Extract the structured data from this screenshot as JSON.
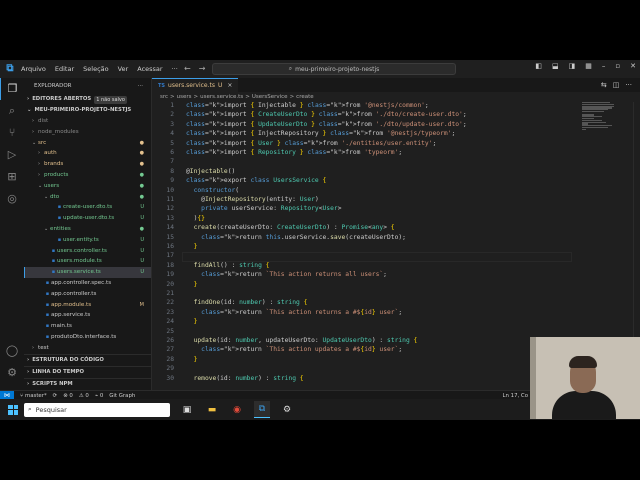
{
  "titlebar": {
    "menu": [
      "Arquivo",
      "Editar",
      "Seleção",
      "Ver",
      "Acessar",
      "···"
    ],
    "command_center": "meu-primeiro-projeto-nestjs"
  },
  "sidebar": {
    "title": "EXPLORADOR",
    "open_editors_label": "EDITORES ABERTOS",
    "unsaved_badge": "1 não salvo",
    "project_label": "MEU-PRIMEIRO-PROJETO-NESTJS",
    "tree": [
      {
        "label": "dist",
        "indent": 1,
        "kind": "folder",
        "collapsed": true,
        "color": "dim",
        "dec": ""
      },
      {
        "label": "node_modules",
        "indent": 1,
        "kind": "folder",
        "collapsed": true,
        "color": "dim",
        "dec": ""
      },
      {
        "label": "src",
        "indent": 1,
        "kind": "folder",
        "collapsed": false,
        "color": "mod",
        "dec": "●"
      },
      {
        "label": "auth",
        "indent": 2,
        "kind": "folder",
        "collapsed": true,
        "color": "mod",
        "dec": "●"
      },
      {
        "label": "brands",
        "indent": 2,
        "kind": "folder",
        "collapsed": true,
        "color": "mod",
        "dec": "●"
      },
      {
        "label": "products",
        "indent": 2,
        "kind": "folder",
        "collapsed": true,
        "color": "unt",
        "dec": "●"
      },
      {
        "label": "users",
        "indent": 2,
        "kind": "folder",
        "collapsed": false,
        "color": "unt",
        "dec": "●"
      },
      {
        "label": "dto",
        "indent": 3,
        "kind": "folder",
        "collapsed": false,
        "color": "unt",
        "dec": "●"
      },
      {
        "label": "create-user.dto.ts",
        "indent": 4,
        "kind": "ts",
        "color": "unt",
        "dec": "U"
      },
      {
        "label": "update-user.dto.ts",
        "indent": 4,
        "kind": "ts",
        "color": "unt",
        "dec": "U"
      },
      {
        "label": "entities",
        "indent": 3,
        "kind": "folder",
        "collapsed": false,
        "color": "unt",
        "dec": "●"
      },
      {
        "label": "user.entity.ts",
        "indent": 4,
        "kind": "ts",
        "color": "unt",
        "dec": "U"
      },
      {
        "label": "users.controller.ts",
        "indent": 3,
        "kind": "ts",
        "color": "unt",
        "dec": "U"
      },
      {
        "label": "users.module.ts",
        "indent": 3,
        "kind": "ts",
        "color": "unt",
        "dec": "U"
      },
      {
        "label": "users.service.ts",
        "indent": 3,
        "kind": "ts",
        "color": "unt",
        "dec": "U",
        "selected": true
      },
      {
        "label": "app.controller.spec.ts",
        "indent": 2,
        "kind": "ts",
        "color": "",
        "dec": ""
      },
      {
        "label": "app.controller.ts",
        "indent": 2,
        "kind": "ts",
        "color": "",
        "dec": ""
      },
      {
        "label": "app.module.ts",
        "indent": 2,
        "kind": "ts",
        "color": "mod",
        "dec": "M"
      },
      {
        "label": "app.service.ts",
        "indent": 2,
        "kind": "ts",
        "color": "",
        "dec": ""
      },
      {
        "label": "main.ts",
        "indent": 2,
        "kind": "ts",
        "color": "",
        "dec": ""
      },
      {
        "label": "produtoDto.interface.ts",
        "indent": 2,
        "kind": "ts",
        "color": "",
        "dec": ""
      },
      {
        "label": "test",
        "indent": 1,
        "kind": "folder",
        "collapsed": true,
        "color": "",
        "dec": ""
      }
    ],
    "outline_label": "ESTRUTURA DO CÓDIGO",
    "timeline_label": "LINHA DO TEMPO",
    "npm_label": "SCRIPTS NPM"
  },
  "editor": {
    "tab_label": "users.service.ts",
    "tab_status": "U",
    "breadcrumb": [
      "src",
      ">",
      "users",
      ">",
      "users.service.ts",
      ">",
      "UsersService",
      ">",
      "create"
    ],
    "code_lines": [
      "import { Injectable } from '@nestjs/common';",
      "import { CreateUserDto } from './dto/create-user.dto';",
      "import { UpdateUserDto } from './dto/update-user.dto';",
      "import { InjectRepository } from '@nestjs/typeorm';",
      "import { User } from './entities/user.entity';",
      "import { Repository } from 'typeorm';",
      "",
      "@Injectable()",
      "export class UsersService {",
      "  constructor(",
      "    @InjectRepository(entity: User)",
      "    private userService: Repository<User>",
      "  ){}",
      "  create(createUserDto: CreateUserDto) : Promise<any> {",
      "    return this.userService.save(createUserDto);",
      "  }",
      "",
      "  findAll() : string {",
      "    return `This action returns all users`;",
      "  }",
      "",
      "  findOne(id: number) : string {",
      "    return `This action returns a #${id} user`;",
      "  }",
      "",
      "  update(id: number, updateUserDto: UpdateUserDto) : string {",
      "    return `This action updates a #${id} user`;",
      "  }",
      "",
      "  remove(id: number) : string {"
    ],
    "current_line": 17
  },
  "statusbar": {
    "branch": "master*",
    "sync": "⟳",
    "errors": "⊗ 0",
    "warnings": "⚠ 0",
    "ports": "⌁ 0",
    "git_graph": "Git Graph",
    "position": "Ln 17, Co"
  },
  "taskbar": {
    "search_placeholder": "Pesquisar"
  },
  "colors": {
    "accent": "#0078d4",
    "modified": "#e2c08d",
    "untracked": "#73c991"
  }
}
